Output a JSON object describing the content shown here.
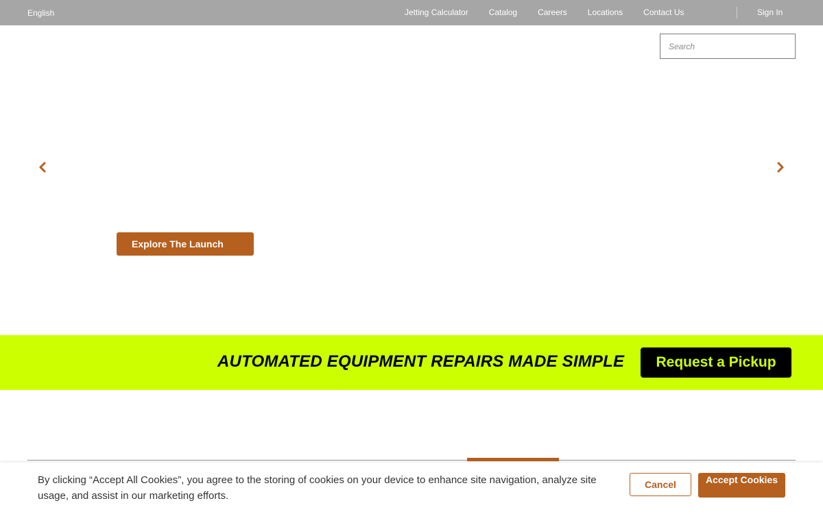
{
  "topbar": {
    "language": "English",
    "nav": [
      {
        "label": "Jetting Calculator"
      },
      {
        "label": "Catalog"
      },
      {
        "label": "Careers"
      },
      {
        "label": "Locations"
      },
      {
        "label": "Contact Us"
      }
    ],
    "sign_in": "Sign In"
  },
  "search": {
    "placeholder": "Search",
    "value": ""
  },
  "carousel": {
    "prev_icon": "chevron-left-icon",
    "next_icon": "chevron-right-icon",
    "cta_label": "Explore The Launch"
  },
  "promo": {
    "headline": "AUTOMATED EQUIPMENT REPAIRS MADE SIMPLE",
    "button_label": "Request a Pickup"
  },
  "cookie_banner": {
    "message": "By clicking “Accept All Cookies”, you agree to the storing of cookies on your device to enhance site navigation, analyze site usage, and assist in our marketing efforts.",
    "cancel_label": "Cancel",
    "accept_label": "Accept Cookies"
  },
  "colors": {
    "topbar_bg": "#a6a6a6",
    "accent": "#b5601f",
    "promo_bg": "#ccff00",
    "promo_button_bg": "#000000"
  }
}
